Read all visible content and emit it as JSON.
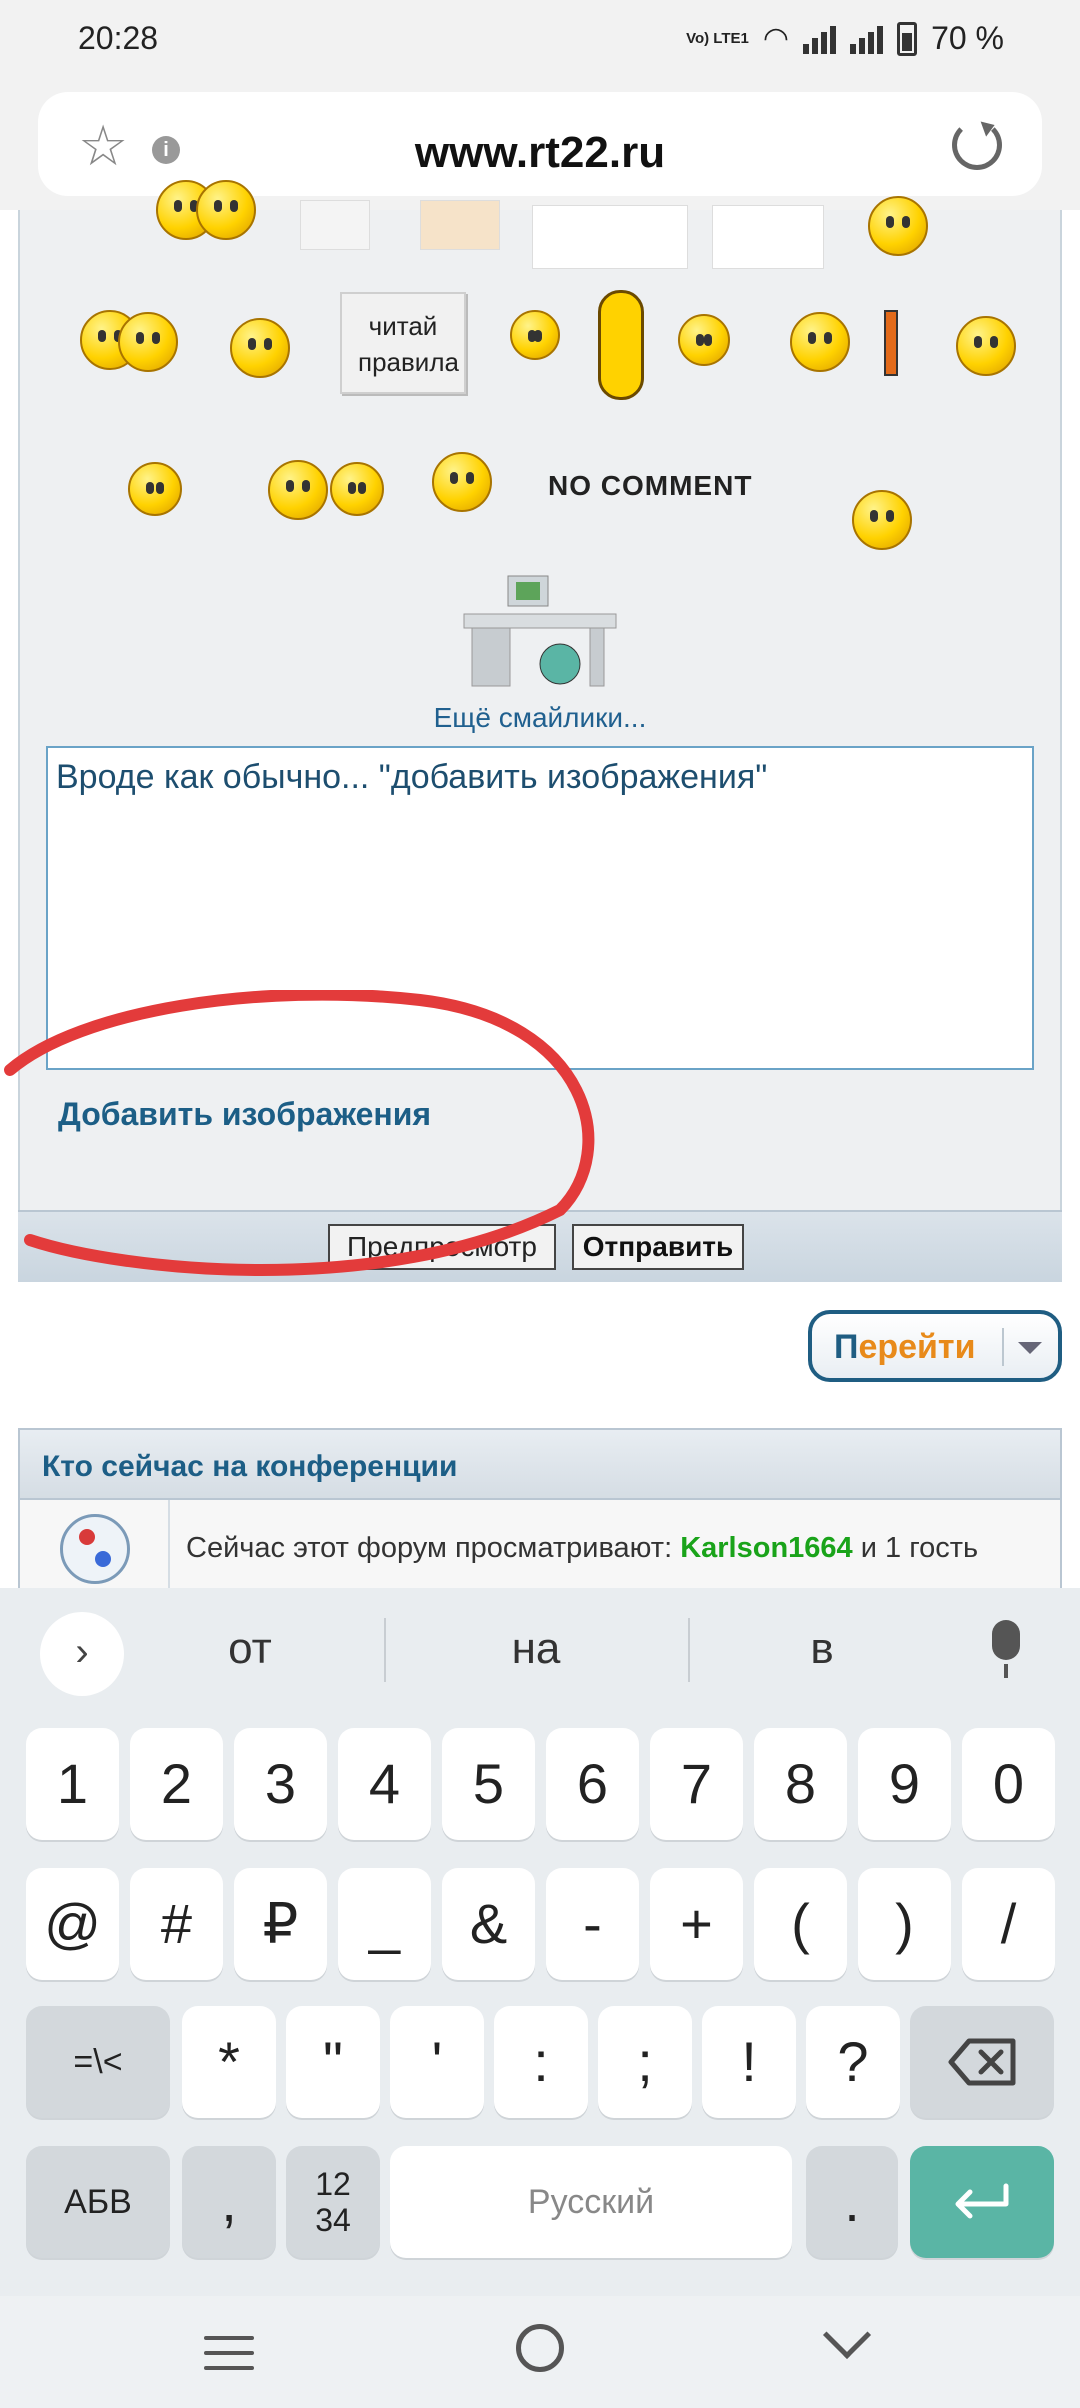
{
  "status_bar": {
    "time": "20:28",
    "network_label": "Vo) LTE1",
    "battery": "70 %"
  },
  "browser": {
    "url": "www.rt22.ru"
  },
  "smileys": {
    "rules_label": "читай правила",
    "nocomment_label": "NO COMMENT",
    "more_link": "Ещё смайлики..."
  },
  "editor": {
    "text": "Вроде как обычно... \"добавить изображения\"",
    "add_images": "Добавить изображения"
  },
  "buttons": {
    "preview": "Предпросмотр",
    "send": "Отправить",
    "goto": "Перейти"
  },
  "who_online": {
    "title": "Кто сейчас на конференции",
    "prefix": "Сейчас этот форум просматривают: ",
    "user": "Karlson1664",
    "suffix": " и 1 гость"
  },
  "keyboard": {
    "suggestions": [
      "от",
      "на",
      "в"
    ],
    "row1": [
      "1",
      "2",
      "3",
      "4",
      "5",
      "6",
      "7",
      "8",
      "9",
      "0"
    ],
    "row2": [
      "@",
      "#",
      "₽",
      "_",
      "&",
      "-",
      "+",
      "(",
      ")",
      "/"
    ],
    "row3": [
      "=\\<",
      "*",
      "\"",
      "'",
      ":",
      ";",
      "!",
      "?"
    ],
    "abv": "АБВ",
    "comma": ",",
    "numpad": "12\n34",
    "space": "Русский",
    "period": "."
  },
  "colors": {
    "link": "#1c5e86",
    "online_user": "#1aa31a",
    "enter_key": "#5ab5a5",
    "annotation": "#e33b3b"
  }
}
